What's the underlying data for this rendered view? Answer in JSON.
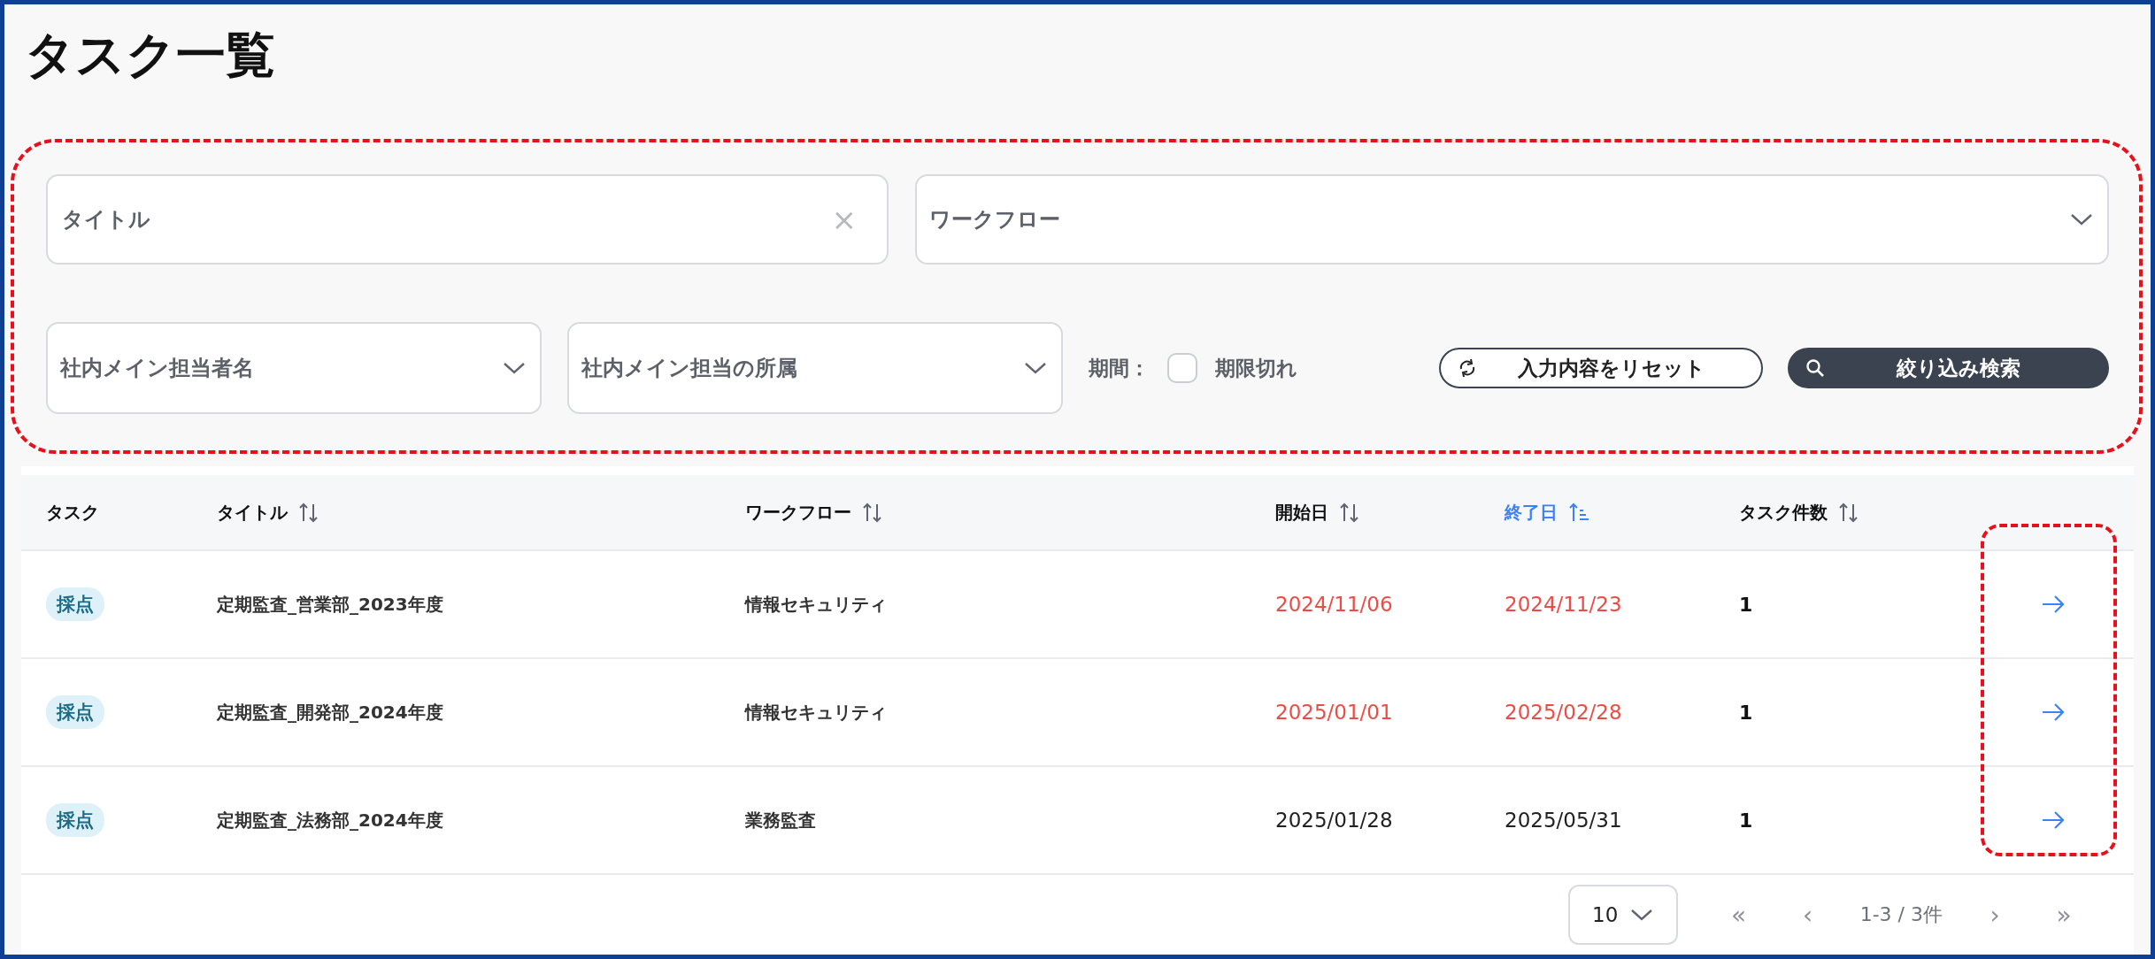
{
  "page": {
    "title": "タスク一覧"
  },
  "filters": {
    "title_field": {
      "placeholder": "タイトル",
      "clear": "×"
    },
    "workflow_select": {
      "placeholder": "ワークフロー"
    },
    "owner_select": {
      "placeholder": "社内メイン担当者名"
    },
    "department_select": {
      "placeholder": "社内メイン担当の所属"
    },
    "period_label": "期間：",
    "expired_checkbox": {
      "label": "期限切れ",
      "checked": false
    },
    "reset_button": "入力内容をリセット",
    "search_button": "絞り込み検索"
  },
  "table": {
    "columns": [
      {
        "label": "タスク",
        "sorted": false,
        "sortable": false
      },
      {
        "label": "タイトル",
        "sorted": false,
        "sortable": true
      },
      {
        "label": "ワークフロー",
        "sorted": false,
        "sortable": true
      },
      {
        "label": "開始日",
        "sorted": false,
        "sortable": true
      },
      {
        "label": "終了日",
        "sorted": true,
        "sortable": true
      },
      {
        "label": "タスク件数",
        "sorted": false,
        "sortable": true
      }
    ],
    "rows": [
      {
        "task": "採点",
        "title": "定期監査_営業部_2023年度",
        "workflow": "情報セキュリティ",
        "start": "2024/11/06",
        "end": "2024/11/23",
        "count": "1",
        "overdue": true
      },
      {
        "task": "採点",
        "title": "定期監査_開発部_2024年度",
        "workflow": "情報セキュリティ",
        "start": "2025/01/01",
        "end": "2025/02/28",
        "count": "1",
        "overdue": true
      },
      {
        "task": "採点",
        "title": "定期監査_法務部_2024年度",
        "workflow": "業務監査",
        "start": "2025/01/28",
        "end": "2025/05/31",
        "count": "1",
        "overdue": false
      }
    ]
  },
  "pagination": {
    "page_size": "10",
    "first": "«",
    "prev": "‹",
    "range": "1-3 / 3件",
    "next": "›",
    "last": "»"
  }
}
